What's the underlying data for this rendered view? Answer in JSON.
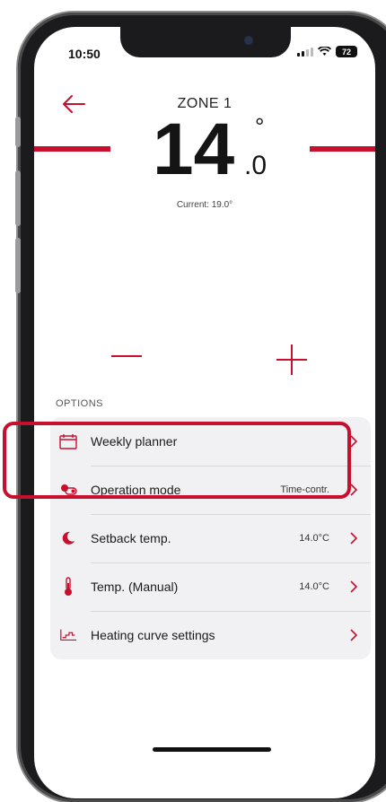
{
  "status_bar": {
    "time": "10:50",
    "battery": "72"
  },
  "header": {
    "zone_title": "ZONE 1"
  },
  "temperature": {
    "set_whole": "14",
    "set_decimal": ".0",
    "degree_symbol": "°",
    "current": "Current: 19.0°"
  },
  "options": {
    "section_label": "OPTIONS",
    "items": [
      {
        "label": "Weekly planner",
        "value": "",
        "icon": "calendar-icon"
      },
      {
        "label": "Operation mode",
        "value": "Time-contr.",
        "icon": "toggle-mode-icon"
      },
      {
        "label": "Setback temp.",
        "value": "14.0°C",
        "icon": "moon-icon"
      },
      {
        "label": "Temp. (Manual)",
        "value": "14.0°C",
        "icon": "thermometer-icon"
      },
      {
        "label": "Heating curve settings",
        "value": "",
        "icon": "heating-curve-icon"
      }
    ]
  },
  "colors": {
    "accent": "#c8102e",
    "card_bg": "#f1f1f4"
  }
}
